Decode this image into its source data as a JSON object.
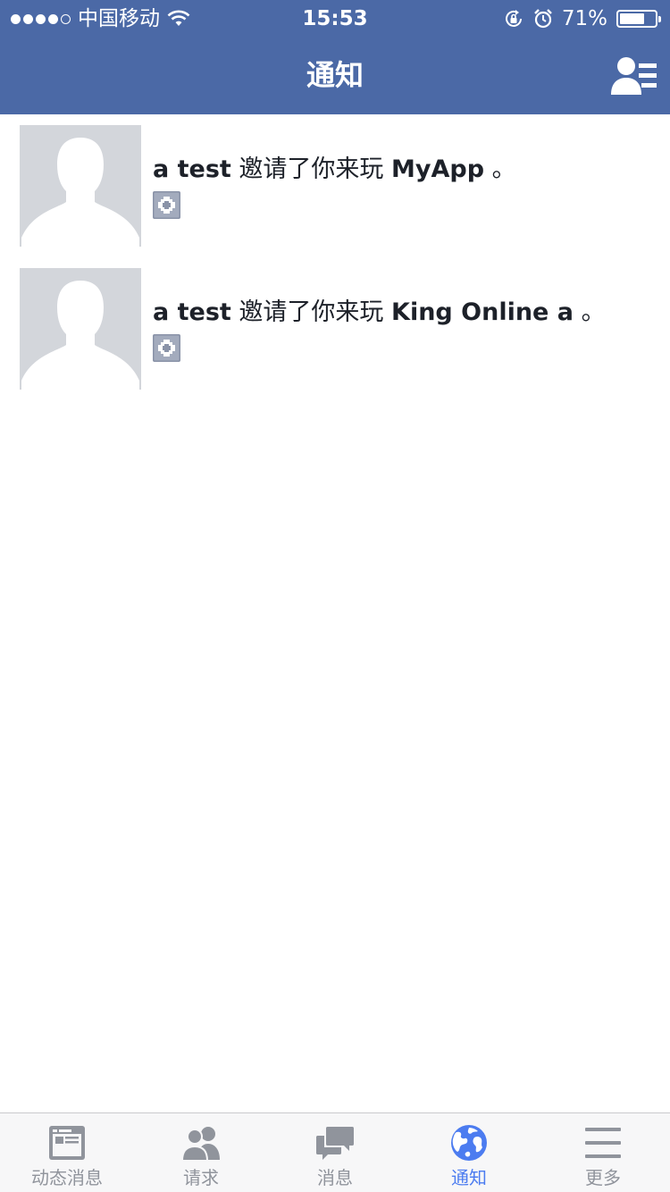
{
  "status_bar": {
    "carrier": "中国移动",
    "time": "15:53",
    "battery": "71%",
    "battery_level": 0.71,
    "signal_dots_filled": 4,
    "signal_dots_total": 5,
    "icons": [
      "signal-icon",
      "wifi-icon",
      "orientation-lock-icon",
      "alarm-icon",
      "battery-icon"
    ]
  },
  "nav": {
    "title": "通知",
    "right_icon": "friends-list-icon"
  },
  "notifications": [
    {
      "actor": "a test",
      "action": "邀请了你来玩",
      "app": "MyApp",
      "end": "。",
      "icon": "app-icon"
    },
    {
      "actor": "a test",
      "action": "邀请了你来玩",
      "app": "King Online a",
      "end": "。",
      "icon": "app-icon"
    }
  ],
  "tabs": [
    {
      "label": "动态消息",
      "icon": "news-feed-icon",
      "active": false
    },
    {
      "label": "请求",
      "icon": "friend-requests-icon",
      "active": false
    },
    {
      "label": "消息",
      "icon": "messages-icon",
      "active": false
    },
    {
      "label": "通知",
      "icon": "globe-icon",
      "active": true
    },
    {
      "label": "更多",
      "icon": "menu-icon",
      "active": false
    }
  ],
  "colors": {
    "header": "#4b69a6",
    "active_tab": "#4c7cf0",
    "inactive_tab": "#90949c",
    "text": "#1d2129",
    "avatar_bg": "#d3d6db"
  }
}
